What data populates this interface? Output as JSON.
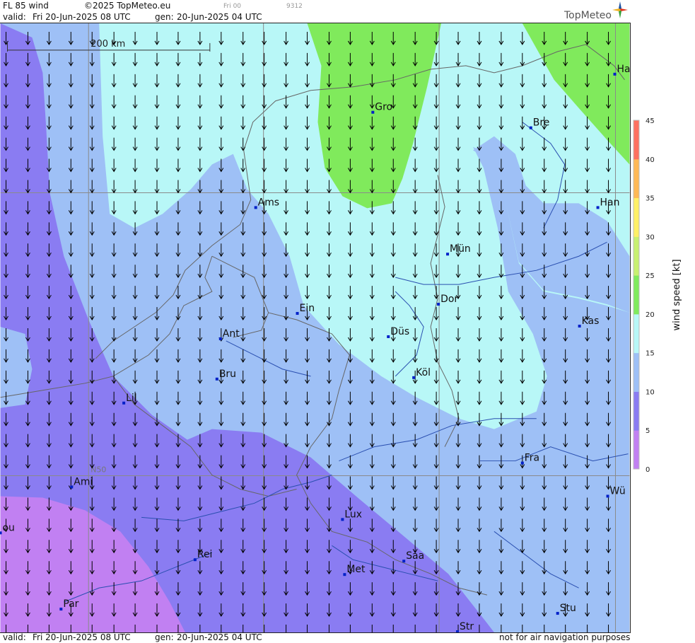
{
  "header": {
    "product": "FL 85 wind",
    "copyright": "©2025 TopMeteo.eu",
    "run_marker": "Fri 00",
    "code": "9312",
    "valid_label": "valid:",
    "valid_value": "Fri  20-Jun-2025  08 UTC",
    "gen_label": "gen:",
    "gen_value": "20-Jun-2025 04 UTC",
    "brand": "TopMeteo"
  },
  "footer": {
    "valid_label": "valid:",
    "valid_value": "Fri  20-Jun-2025  08 UTC",
    "gen_label": "gen:",
    "gen_value": "20-Jun-2025 04 UTC",
    "disclaimer": "not for air navigation purposes"
  },
  "scale_bar": {
    "label": "200 km"
  },
  "graticule": {
    "lat_label": "N50"
  },
  "legend": {
    "title": "wind  speed  [kt]",
    "ticks": [
      "45",
      "40",
      "35",
      "30",
      "25",
      "20",
      "15",
      "10",
      "5",
      "0"
    ],
    "colors": {
      "0_5": "#c180f2",
      "5_10": "#8a7cf2",
      "10_15": "#9ec0f6",
      "15_20": "#b8f7f7",
      "20_25": "#80ea5c",
      "25_30": "#c8f070",
      "30_35": "#fff066",
      "35_40": "#ffb855",
      "40_45": "#ff7060"
    }
  },
  "cities": [
    {
      "name": "Ha"
    },
    {
      "name": "Gro"
    },
    {
      "name": "Bre"
    },
    {
      "name": "Ams"
    },
    {
      "name": "Han"
    },
    {
      "name": "Mün"
    },
    {
      "name": "Ein"
    },
    {
      "name": "Dor"
    },
    {
      "name": "Kas"
    },
    {
      "name": "Ant"
    },
    {
      "name": "Düs"
    },
    {
      "name": "Köl"
    },
    {
      "name": "Bru"
    },
    {
      "name": "Lil"
    },
    {
      "name": "Fra"
    },
    {
      "name": "Ami"
    },
    {
      "name": "Wü"
    },
    {
      "name": "ou"
    },
    {
      "name": "Lux"
    },
    {
      "name": "Rei"
    },
    {
      "name": "Saa"
    },
    {
      "name": "Met"
    },
    {
      "name": "Stu"
    },
    {
      "name": "Par"
    },
    {
      "name": "Str"
    }
  ],
  "wind": {
    "direction": "north",
    "arrow_color": "#000000"
  }
}
